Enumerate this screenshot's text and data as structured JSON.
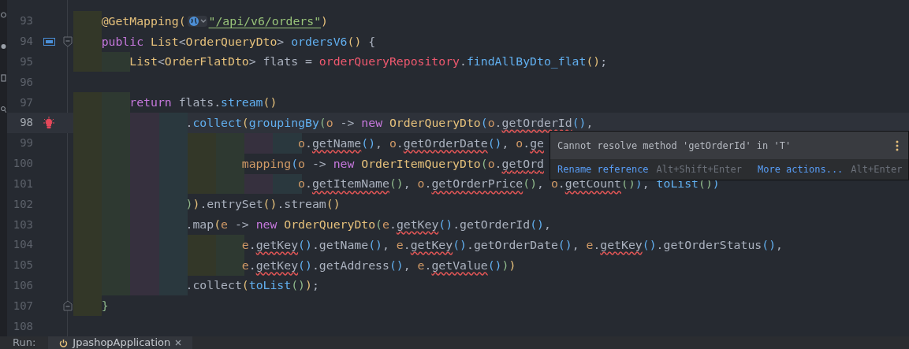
{
  "editor": {
    "lines": [
      {
        "number": "93",
        "current": false,
        "tokens": [
          {
            "text": "    @GetMapping",
            "kind": "annotation"
          },
          {
            "text": "(",
            "kind": "paren1"
          },
          {
            "kind": "globe"
          },
          {
            "text": "\"/api/v6/orders\"",
            "kind": "url"
          },
          {
            "text": ")",
            "kind": "paren1"
          }
        ]
      },
      {
        "number": "94",
        "current": false,
        "gutter": {
          "kind": "api"
        },
        "fold": {
          "kind": "start"
        },
        "tokens": [
          {
            "text": "    public ",
            "kind": "keyword"
          },
          {
            "text": "List",
            "kind": "type"
          },
          {
            "text": "<",
            "kind": "plain"
          },
          {
            "text": "OrderQueryDto",
            "kind": "type"
          },
          {
            "text": "> ",
            "kind": "plain"
          },
          {
            "text": "ordersV6",
            "kind": "method"
          },
          {
            "text": "()",
            "kind": "paren1"
          },
          {
            "text": " {",
            "kind": "plain"
          }
        ]
      },
      {
        "number": "95",
        "current": false,
        "tokens": [
          {
            "text": "        List",
            "kind": "type"
          },
          {
            "text": "<",
            "kind": "plain"
          },
          {
            "text": "OrderFlatDto",
            "kind": "type"
          },
          {
            "text": "> flats = ",
            "kind": "plain"
          },
          {
            "text": "orderQueryRepository",
            "kind": "field"
          },
          {
            "text": ".",
            "kind": "plain"
          },
          {
            "text": "findAllByDto_flat",
            "kind": "method"
          },
          {
            "text": "()",
            "kind": "paren1"
          },
          {
            "text": ";",
            "kind": "plain"
          }
        ]
      },
      {
        "number": "96",
        "current": false
      },
      {
        "number": "97",
        "current": false,
        "tokens": [
          {
            "text": "        return",
            "kind": "keyword"
          },
          {
            "text": " flats.",
            "kind": "plain"
          },
          {
            "text": "stream",
            "kind": "method"
          },
          {
            "text": "()",
            "kind": "paren1"
          }
        ]
      },
      {
        "number": "98",
        "current": true,
        "gutter": {
          "kind": "bulb"
        },
        "tokens": [
          {
            "text": "                .",
            "kind": "plain"
          },
          {
            "text": "collect",
            "kind": "method"
          },
          {
            "text": "(",
            "kind": "paren1"
          },
          {
            "text": "groupingBy",
            "kind": "method"
          },
          {
            "text": "(",
            "kind": "paren2"
          },
          {
            "text": "o",
            "kind": "param"
          },
          {
            "text": " -> ",
            "kind": "plain"
          },
          {
            "text": "new ",
            "kind": "keyword"
          },
          {
            "text": "OrderQueryDto",
            "kind": "type"
          },
          {
            "text": "(",
            "kind": "paren3"
          },
          {
            "text": "o",
            "kind": "param"
          },
          {
            "text": ".",
            "kind": "plain"
          },
          {
            "text": "getOrderId",
            "kind": "unresolved"
          },
          {
            "text": "()",
            "kind": "paren3"
          },
          {
            "text": ",",
            "kind": "plain"
          }
        ]
      },
      {
        "number": "99",
        "current": false,
        "tokens": [
          {
            "text": "                                o",
            "kind": "param"
          },
          {
            "text": ".",
            "kind": "plain"
          },
          {
            "text": "getName",
            "kind": "unresolved"
          },
          {
            "text": "()",
            "kind": "paren3"
          },
          {
            "text": ", ",
            "kind": "plain"
          },
          {
            "text": "o",
            "kind": "param"
          },
          {
            "text": ".",
            "kind": "plain"
          },
          {
            "text": "getOrderDate",
            "kind": "unresolved"
          },
          {
            "text": "()",
            "kind": "paren3"
          },
          {
            "text": ", ",
            "kind": "plain"
          },
          {
            "text": "o",
            "kind": "param"
          },
          {
            "text": ".",
            "kind": "plain"
          },
          {
            "text": "ge",
            "kind": "unresolved"
          }
        ]
      },
      {
        "number": "100",
        "current": false,
        "tokens": [
          {
            "text": "                        mapping",
            "kind": "static"
          },
          {
            "text": "(",
            "kind": "paren3"
          },
          {
            "text": "o",
            "kind": "param"
          },
          {
            "text": " -> ",
            "kind": "plain"
          },
          {
            "text": "new ",
            "kind": "keyword"
          },
          {
            "text": "OrderItemQueryDto",
            "kind": "type"
          },
          {
            "text": "(",
            "kind": "paren2"
          },
          {
            "text": "o",
            "kind": "param"
          },
          {
            "text": ".",
            "kind": "plain"
          },
          {
            "text": "getOrd",
            "kind": "unresolved"
          }
        ]
      },
      {
        "number": "101",
        "current": false,
        "tokens": [
          {
            "text": "                                o",
            "kind": "param"
          },
          {
            "text": ".",
            "kind": "plain"
          },
          {
            "text": "getItemName",
            "kind": "unresolved"
          },
          {
            "text": "()",
            "kind": "paren2"
          },
          {
            "text": ", ",
            "kind": "plain"
          },
          {
            "text": "o",
            "kind": "param"
          },
          {
            "text": ".",
            "kind": "plain"
          },
          {
            "text": "getOrderPrice",
            "kind": "unresolved"
          },
          {
            "text": "()",
            "kind": "paren2"
          },
          {
            "text": ", ",
            "kind": "plain"
          },
          {
            "text": "o",
            "kind": "param"
          },
          {
            "text": ".",
            "kind": "plain"
          },
          {
            "text": "getCount",
            "kind": "unresolved"
          },
          {
            "text": "()",
            "kind": "paren2"
          },
          {
            "text": ")",
            "kind": "paren3"
          },
          {
            "text": ", ",
            "kind": "plain"
          },
          {
            "text": "toList",
            "kind": "method"
          },
          {
            "text": "()",
            "kind": "paren2"
          },
          {
            "text": ")",
            "kind": "paren3"
          }
        ]
      },
      {
        "number": "102",
        "current": false,
        "tokens": [
          {
            "text": "                )",
            "kind": "paren2"
          },
          {
            "text": ")",
            "kind": "paren1"
          },
          {
            "text": ".entrySet",
            "kind": "plain"
          },
          {
            "text": "()",
            "kind": "paren1"
          },
          {
            "text": ".stream",
            "kind": "plain"
          },
          {
            "text": "()",
            "kind": "paren1"
          }
        ]
      },
      {
        "number": "103",
        "current": false,
        "tokens": [
          {
            "text": "                .map",
            "kind": "plain"
          },
          {
            "text": "(",
            "kind": "paren1"
          },
          {
            "text": "e",
            "kind": "param"
          },
          {
            "text": " -> ",
            "kind": "plain"
          },
          {
            "text": "new ",
            "kind": "keyword"
          },
          {
            "text": "OrderQueryDto",
            "kind": "type"
          },
          {
            "text": "(",
            "kind": "paren2"
          },
          {
            "text": "e",
            "kind": "param"
          },
          {
            "text": ".",
            "kind": "plain"
          },
          {
            "text": "getKey",
            "kind": "unresolved"
          },
          {
            "text": "()",
            "kind": "paren3"
          },
          {
            "text": ".getOrderId",
            "kind": "plain"
          },
          {
            "text": "()",
            "kind": "paren3"
          },
          {
            "text": ",",
            "kind": "plain"
          }
        ]
      },
      {
        "number": "104",
        "current": false,
        "tokens": [
          {
            "text": "                        e",
            "kind": "param"
          },
          {
            "text": ".",
            "kind": "plain"
          },
          {
            "text": "getKey",
            "kind": "unresolved"
          },
          {
            "text": "()",
            "kind": "paren3"
          },
          {
            "text": ".getName",
            "kind": "plain"
          },
          {
            "text": "()",
            "kind": "paren3"
          },
          {
            "text": ", ",
            "kind": "plain"
          },
          {
            "text": "e",
            "kind": "param"
          },
          {
            "text": ".",
            "kind": "plain"
          },
          {
            "text": "getKey",
            "kind": "unresolved"
          },
          {
            "text": "()",
            "kind": "paren3"
          },
          {
            "text": ".getOrderDate",
            "kind": "plain"
          },
          {
            "text": "()",
            "kind": "paren3"
          },
          {
            "text": ", ",
            "kind": "plain"
          },
          {
            "text": "e",
            "kind": "param"
          },
          {
            "text": ".",
            "kind": "plain"
          },
          {
            "text": "getKey",
            "kind": "unresolved"
          },
          {
            "text": "()",
            "kind": "paren3"
          },
          {
            "text": ".getOrderStatus",
            "kind": "plain"
          },
          {
            "text": "()",
            "kind": "paren3"
          },
          {
            "text": ",",
            "kind": "plain"
          }
        ]
      },
      {
        "number": "105",
        "current": false,
        "tokens": [
          {
            "text": "                        e",
            "kind": "param"
          },
          {
            "text": ".",
            "kind": "plain"
          },
          {
            "text": "getKey",
            "kind": "unresolved"
          },
          {
            "text": "()",
            "kind": "paren3"
          },
          {
            "text": ".getAddress",
            "kind": "plain"
          },
          {
            "text": "()",
            "kind": "paren3"
          },
          {
            "text": ", ",
            "kind": "plain"
          },
          {
            "text": "e",
            "kind": "param"
          },
          {
            "text": ".",
            "kind": "plain"
          },
          {
            "text": "getValue",
            "kind": "unresolved"
          },
          {
            "text": "()",
            "kind": "paren3"
          },
          {
            "text": ")",
            "kind": "paren2"
          },
          {
            "text": ")",
            "kind": "paren1"
          }
        ]
      },
      {
        "number": "106",
        "current": false,
        "tokens": [
          {
            "text": "                .collect",
            "kind": "plain"
          },
          {
            "text": "(",
            "kind": "paren1"
          },
          {
            "text": "toList",
            "kind": "method"
          },
          {
            "text": "()",
            "kind": "paren2"
          },
          {
            "text": ")",
            "kind": "paren1"
          },
          {
            "text": ";",
            "kind": "plain"
          }
        ]
      },
      {
        "number": "107",
        "current": false,
        "fold": {
          "kind": "end"
        },
        "tokens": [
          {
            "text": "    }",
            "kind": "paren2"
          }
        ]
      },
      {
        "number": "108",
        "current": false
      }
    ]
  },
  "popup": {
    "message": "Cannot resolve method 'getOrderId' in 'T'",
    "actions": [
      {
        "label": "Rename reference",
        "shortcut": "Alt+Shift+Enter"
      },
      {
        "label": "More actions...",
        "shortcut": "Alt+Enter"
      }
    ]
  },
  "run_bar": {
    "label": "Run:",
    "tabs": [
      {
        "label": "JpashopApplication",
        "selected": true
      }
    ]
  }
}
